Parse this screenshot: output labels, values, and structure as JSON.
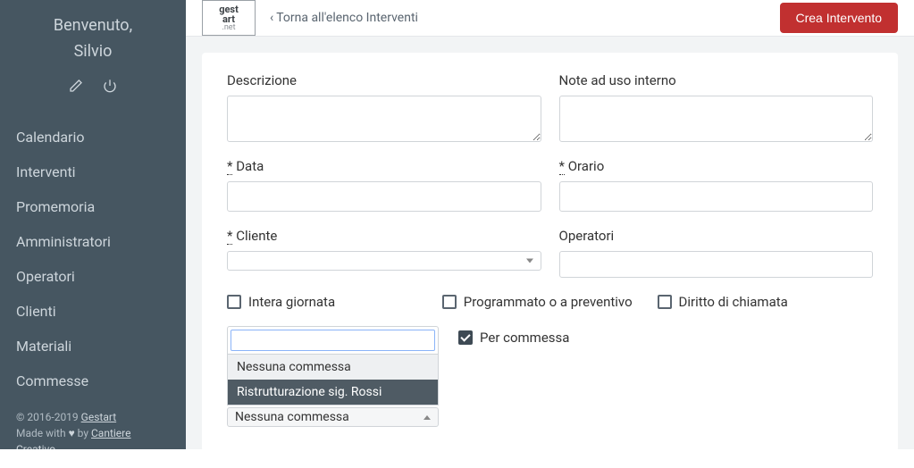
{
  "sidebar": {
    "welcome_label": "Benvenuto,",
    "user_name": "Silvio",
    "nav": [
      "Calendario",
      "Interventi",
      "Promemoria",
      "Amministratori",
      "Operatori",
      "Clienti",
      "Materiali",
      "Commesse"
    ],
    "footer": {
      "copyright": "© 2016-2019 ",
      "brand": "Gestart",
      "made_with": "Made with ",
      "heart": "♥",
      "by": " by ",
      "agency": "Cantiere Creativo"
    }
  },
  "topbar": {
    "back_caret": "‹",
    "back_label": "Torna all'elenco Interventi",
    "primary_btn": "Crea Intervento",
    "logo": {
      "l1": "gest",
      "l2": "art",
      "l3": ".net"
    }
  },
  "form": {
    "required_mark": "*",
    "descrizione_label": "Descrizione",
    "note_label": "Note ad uso interno",
    "data_label": " Data",
    "orario_label": " Orario",
    "cliente_label": " Cliente",
    "operatori_label": "Operatori",
    "chk_intera": "Intera giornata",
    "chk_programmato": "Programmato o a preventivo",
    "chk_diritto": "Diritto di chiamata",
    "chk_per_commessa": "Per commessa",
    "commessa_options": [
      "Nessuna commessa",
      "Ristrutturazione sig. Rossi"
    ],
    "commessa_selected": "Nessuna commessa"
  }
}
